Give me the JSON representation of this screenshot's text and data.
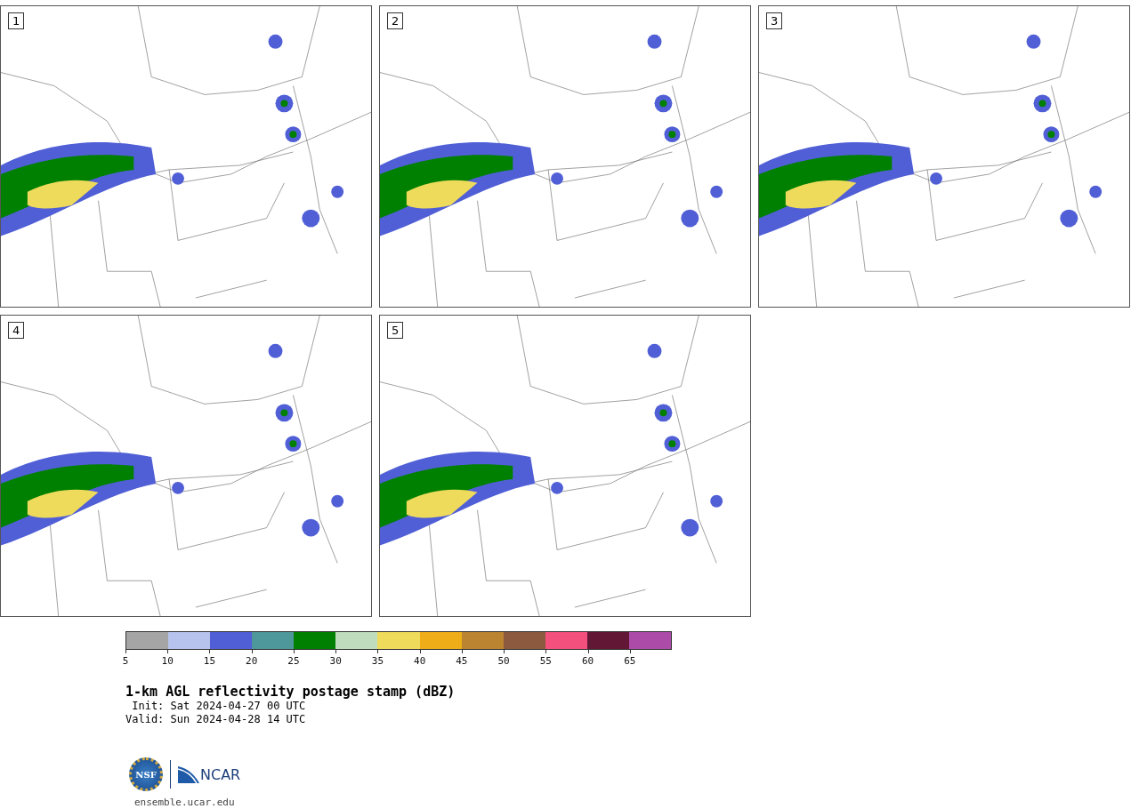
{
  "panels": [
    {
      "label": "1"
    },
    {
      "label": "2"
    },
    {
      "label": "3"
    },
    {
      "label": "4"
    },
    {
      "label": "5"
    }
  ],
  "colorbar": {
    "bins": [
      {
        "color": "#a5a5a5"
      },
      {
        "color": "#b7c3ed"
      },
      {
        "color": "#505fd6"
      },
      {
        "color": "#4e979b"
      },
      {
        "color": "#008000"
      },
      {
        "color": "#bfdcbd"
      },
      {
        "color": "#efdb5b"
      },
      {
        "color": "#efae17"
      },
      {
        "color": "#bb8430"
      },
      {
        "color": "#8b5a3f"
      },
      {
        "color": "#f4507d"
      },
      {
        "color": "#621735"
      },
      {
        "color": "#ad4ca8"
      }
    ],
    "ticks": [
      "5",
      "10",
      "15",
      "20",
      "25",
      "30",
      "35",
      "40",
      "45",
      "50",
      "55",
      "60",
      "65"
    ]
  },
  "title": "1-km AGL reflectivity postage stamp (dBZ)",
  "init": " Init: Sat 2024-04-27 00 UTC",
  "valid": "Valid: Sun 2024-04-28 14 UTC",
  "logo": {
    "nsf": "NSF",
    "ncar": "NCAR"
  },
  "footer": "ensemble.ucar.edu"
}
